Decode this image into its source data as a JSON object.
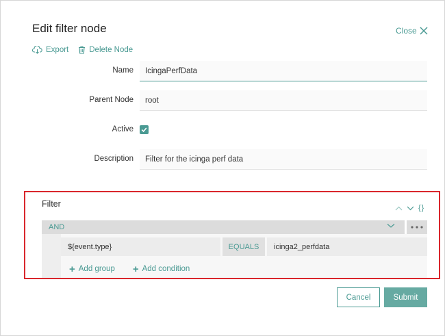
{
  "dialog": {
    "title": "Edit filter node",
    "close_label": "Close"
  },
  "toolbar": {
    "export_label": "Export",
    "delete_label": "Delete Node"
  },
  "form": {
    "name_label": "Name",
    "name_value": "IcingaPerfData",
    "parent_label": "Parent Node",
    "parent_value": "root",
    "active_label": "Active",
    "active_checked": true,
    "description_label": "Description",
    "description_value": "Filter for the icinga perf data"
  },
  "filter": {
    "title": "Filter",
    "json_toggle": "{}",
    "group_operator": "AND",
    "condition": {
      "field": "${event.type}",
      "operator": "EQUALS",
      "value": "icinga2_perfdata"
    },
    "add_group_label": "Add group",
    "add_condition_label": "Add condition"
  },
  "actions": {
    "cancel_label": "Cancel",
    "submit_label": "Submit"
  },
  "colors": {
    "accent": "#4a9a93",
    "highlight_border": "#d9262c",
    "submit_bg": "#66aaa2"
  }
}
